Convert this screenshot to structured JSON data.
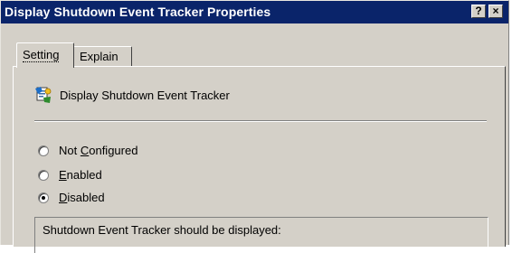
{
  "window": {
    "title": "Display Shutdown Event Tracker Properties",
    "help_button": "?",
    "close_button": "×"
  },
  "tabs": [
    {
      "label": "Setting",
      "selected": true
    },
    {
      "label": "Explain",
      "selected": false
    }
  ],
  "policy": {
    "name": "Display Shutdown Event Tracker",
    "icon": "policy-setting-icon"
  },
  "radios": [
    {
      "pre": "Not ",
      "key": "C",
      "post": "onfigured",
      "checked": false
    },
    {
      "pre": "",
      "key": "E",
      "post": "nabled",
      "checked": false
    },
    {
      "pre": "",
      "key": "D",
      "post": "isabled",
      "checked": true
    }
  ],
  "options": {
    "text": "Shutdown Event Tracker should be displayed:"
  },
  "colors": {
    "titlebar": "#0a246a",
    "face": "#d4d0c8"
  }
}
